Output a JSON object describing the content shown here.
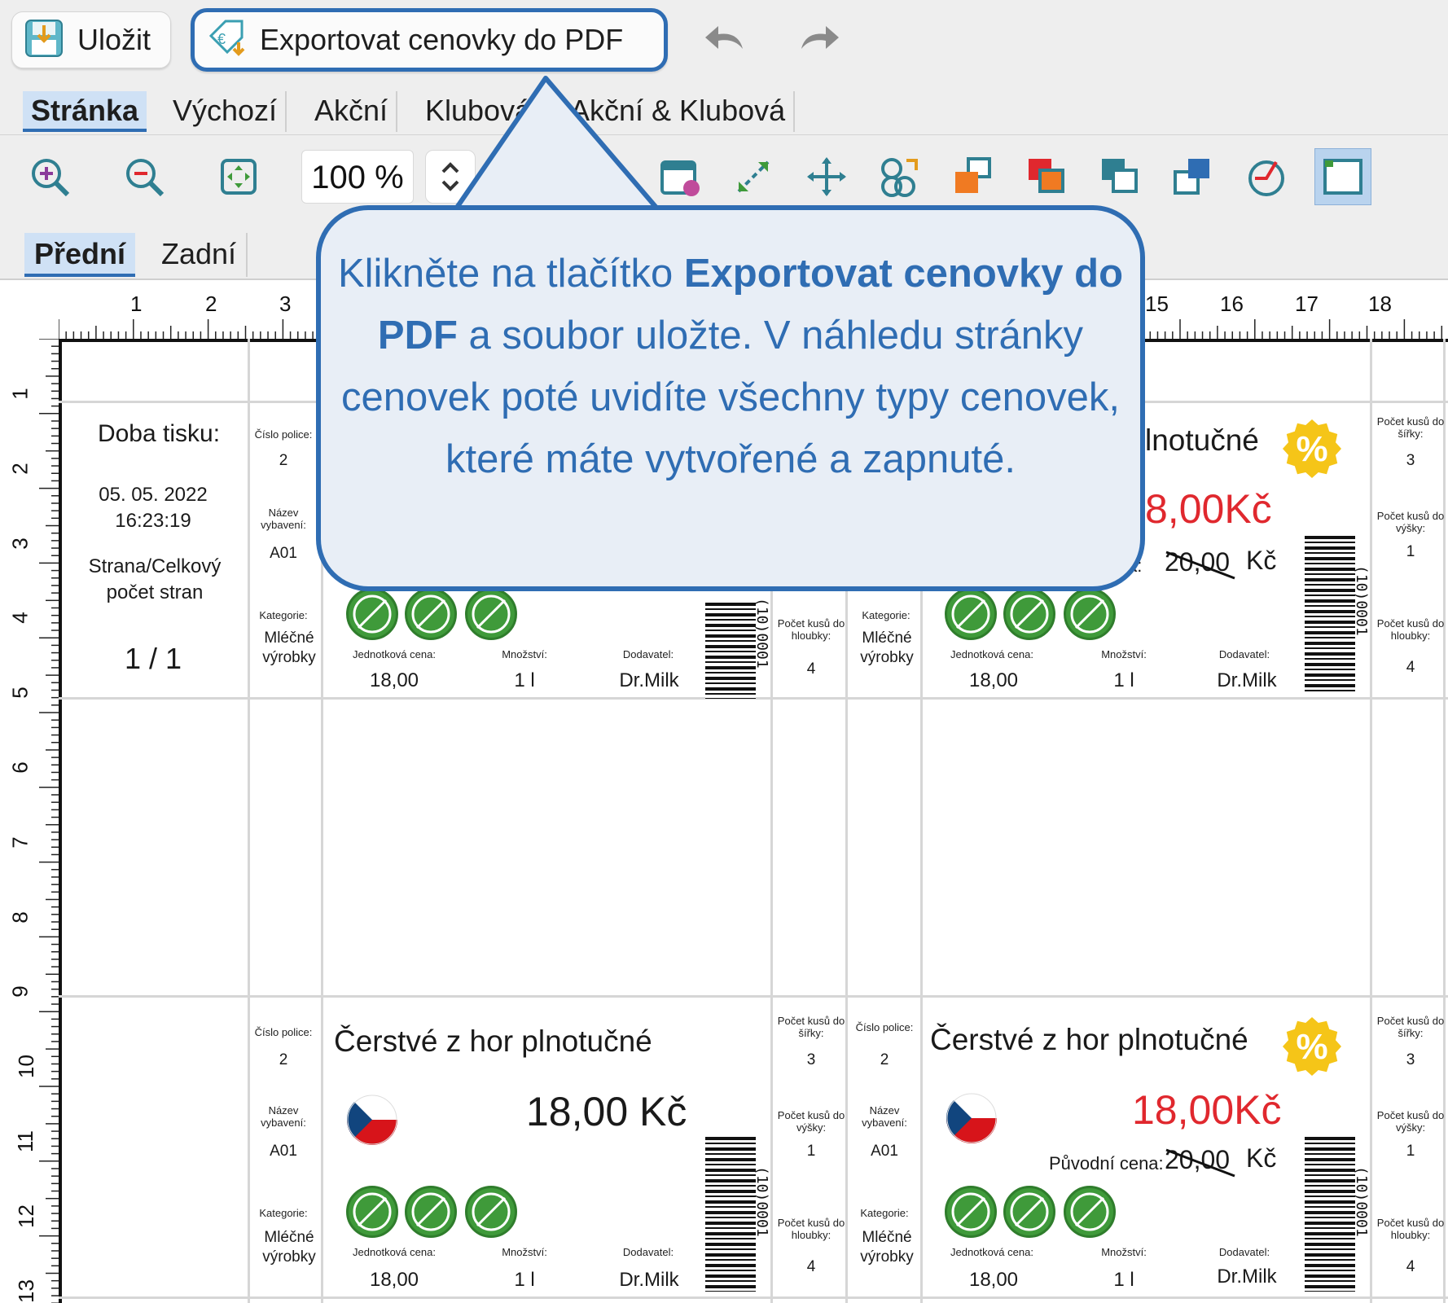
{
  "toolbar": {
    "save_label": "Uložit",
    "export_label": "Exportovat cenovky do PDF"
  },
  "tabs": [
    {
      "label": "Stránka"
    },
    {
      "label": "Výchozí"
    },
    {
      "label": "Akční"
    },
    {
      "label": "Klubová"
    },
    {
      "label": "Akční & Klubová"
    }
  ],
  "zoom": {
    "value": "100 %"
  },
  "faces": [
    {
      "label": "Přední"
    },
    {
      "label": "Zadní"
    }
  ],
  "ruler": {
    "top_visible": [
      "1",
      "2",
      "3",
      "15",
      "16",
      "17",
      "18"
    ],
    "left": [
      "1",
      "2",
      "3",
      "4",
      "5",
      "6",
      "7",
      "8",
      "9",
      "10",
      "11",
      "12",
      "13"
    ]
  },
  "callout": {
    "part1": "Klikněte na tlačítko ",
    "bold": "Exportovat cenovky do PDF",
    "part2": " a soubor uložte. V náhledu stránky cenovek poté uvidíte všechny typy cenovek, které máte vytvořené a zapnuté."
  },
  "print_info": {
    "label": "Doba tisku:",
    "date": "05. 05. 2022",
    "time": "16:23:19",
    "page_label": "Strana/Celkový počet stran",
    "page_value": "1 / 1"
  },
  "label": {
    "shelf_label": "Číslo police:",
    "shelf_value": "2",
    "equip_label": "Název vybavení:",
    "equip_value": "A01",
    "category_label": "Kategorie:",
    "category_value": "Mléčné výrobky",
    "product": "Čerstvé z hor plnotučné",
    "product_partial": "lnotučné",
    "price": "18,00 Kč",
    "promo_price": "18,00Kč",
    "promo_price_partial": "8,00Kč",
    "orig_label": "Původní cena:",
    "orig_partial_label": "a:",
    "orig_price": "20,00",
    "currency": "Kč",
    "unit_price_label": "Jednotková cena:",
    "unit_price": "18,00",
    "qty_label": "Množství:",
    "qty": "1 l",
    "supplier_label": "Dodavatel:",
    "supplier": "Dr.Milk",
    "barcode_text": "(10)0001",
    "width_label": "Počet kusů do šířky:",
    "width_value": "3",
    "height_label": "Počet kusů do výšky:",
    "height_value": "1",
    "depth_label": "Počet kusů do hloubky:",
    "depth_value": "4",
    "discount_symbol": "%"
  },
  "colors": {
    "accent": "#2f6db3",
    "promo": "#e0282e",
    "badge": "#f5c518",
    "allergen": "#3f9a3a"
  }
}
